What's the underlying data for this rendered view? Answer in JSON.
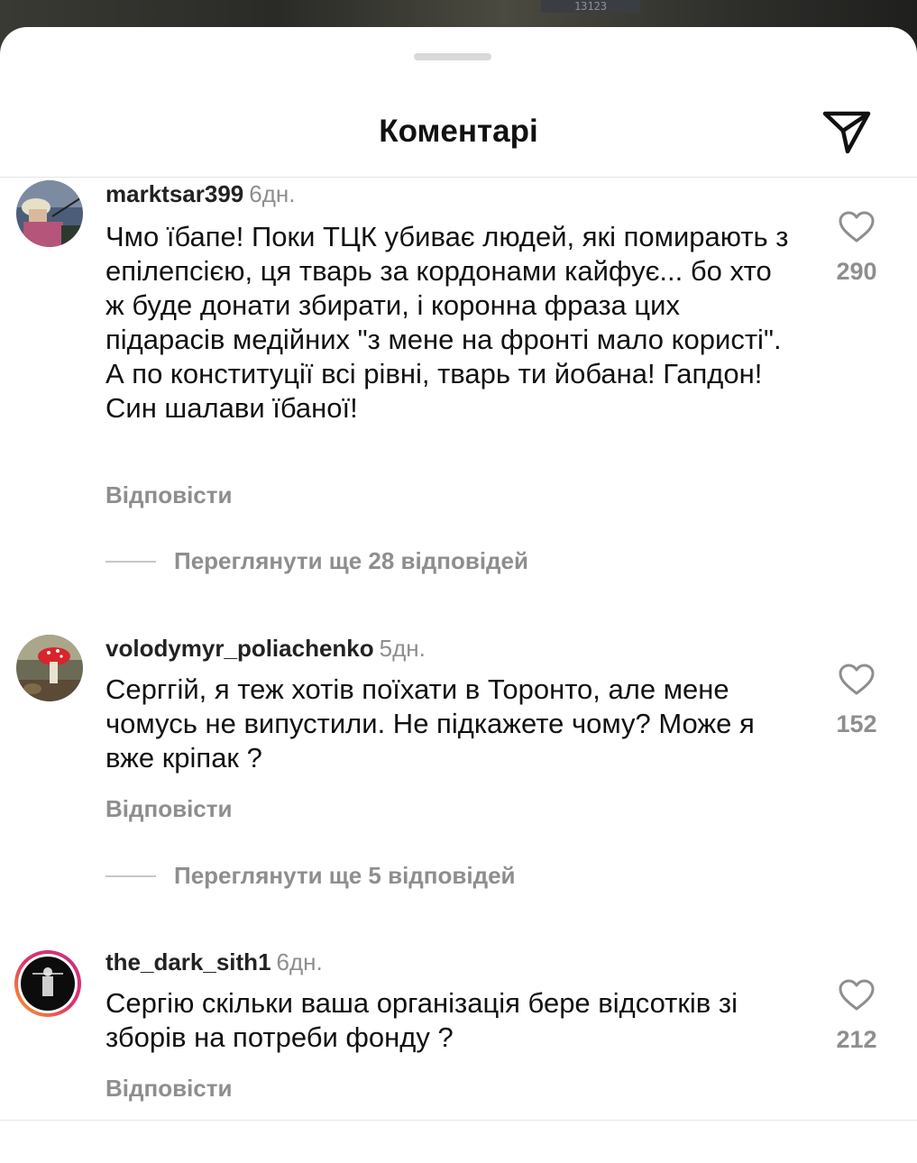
{
  "background": {
    "plate_text": "13123"
  },
  "header": {
    "title": "Коментарі",
    "share_icon": "send-icon"
  },
  "comments": [
    {
      "username": "marktsar399",
      "time": "6дн.",
      "text": "Чмо їбапе! Поки ТЦК убиває людей, які помирають з епілепсією, ця тварь за кордонами кайфує... бо хто ж буде донати збирати, і коронна фраза цих підарасів медійних \"з мене на фронті мало користі\". А по конституції всі рівні, тварь ти йобана! Гапдон! Син шалави їбаної!",
      "likes": "290",
      "reply_label": "Відповісти",
      "view_replies": "Переглянути ще 28 відповідей"
    },
    {
      "username": "volodymyr_poliachenko",
      "time": "5дн.",
      "text": "Серггій, я теж хотів поїхати в Торонто, але мене чомусь не випустили.  Не підкажете чому? Може я вже кріпак ?",
      "likes": "152",
      "reply_label": "Відповісти",
      "view_replies": "Переглянути ще 5 відповідей"
    },
    {
      "username": "the_dark_sith1",
      "time": "6дн.",
      "text": "Сергію скільки ваша організація бере відсотків зі зборів на потреби фонду ?",
      "likes": "212",
      "reply_label": "Відповісти"
    }
  ],
  "colors": {
    "text": "#111111",
    "muted": "#8e8e8e",
    "story_ring": "#d6249f"
  }
}
